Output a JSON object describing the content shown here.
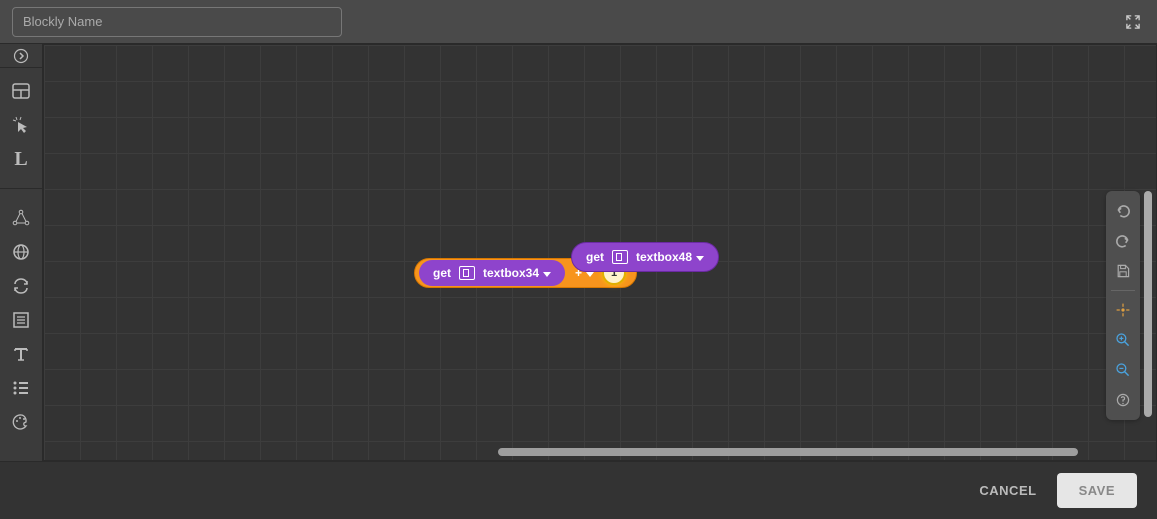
{
  "header": {
    "name_placeholder": "Blockly Name"
  },
  "toolbox": {
    "letter_item": "L"
  },
  "blocks": {
    "outer": {
      "inner_get_label": "get",
      "inner_var_name": "textbox34",
      "operator": "+",
      "number_value": "1"
    },
    "floating": {
      "get_label": "get",
      "var_name": "textbox48"
    }
  },
  "footer": {
    "cancel_label": "CANCEL",
    "save_label": "SAVE"
  }
}
